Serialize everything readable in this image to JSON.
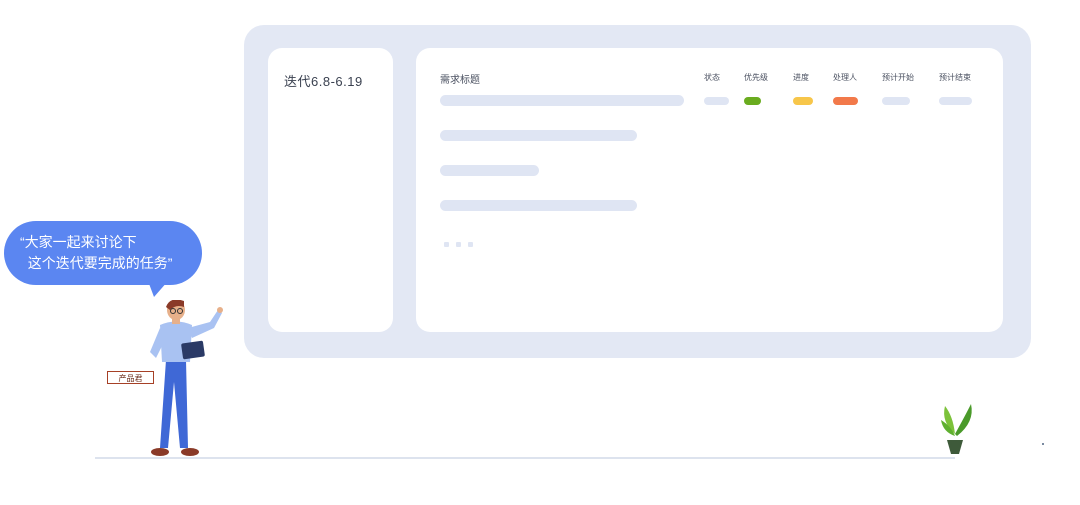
{
  "sidebar": {
    "iteration_title": "迭代6.8-6.19"
  },
  "table": {
    "title_header": "需求标题",
    "columns": [
      {
        "label": "状态",
        "color": "#dfe5f3"
      },
      {
        "label": "优先级",
        "color": "#6aac1f"
      },
      {
        "label": "进度",
        "color": "#f7c64a"
      },
      {
        "label": "处理人",
        "color": "#f2794a"
      },
      {
        "label": "预计开始",
        "color": "#dfe5f3"
      },
      {
        "label": "预计结束",
        "color": "#dfe5f3"
      }
    ],
    "placeholder_rows": 4,
    "more_indicator_dots": 3
  },
  "speech_bubble": {
    "text": "“大家一起来讨论下\n  这个迭代要完成的任务”"
  },
  "character": {
    "badge": "产品君"
  },
  "colors": {
    "board_bg": "#e3e8f4",
    "bubble_bg": "#5b86f1",
    "placeholder": "#dfe5f3"
  }
}
